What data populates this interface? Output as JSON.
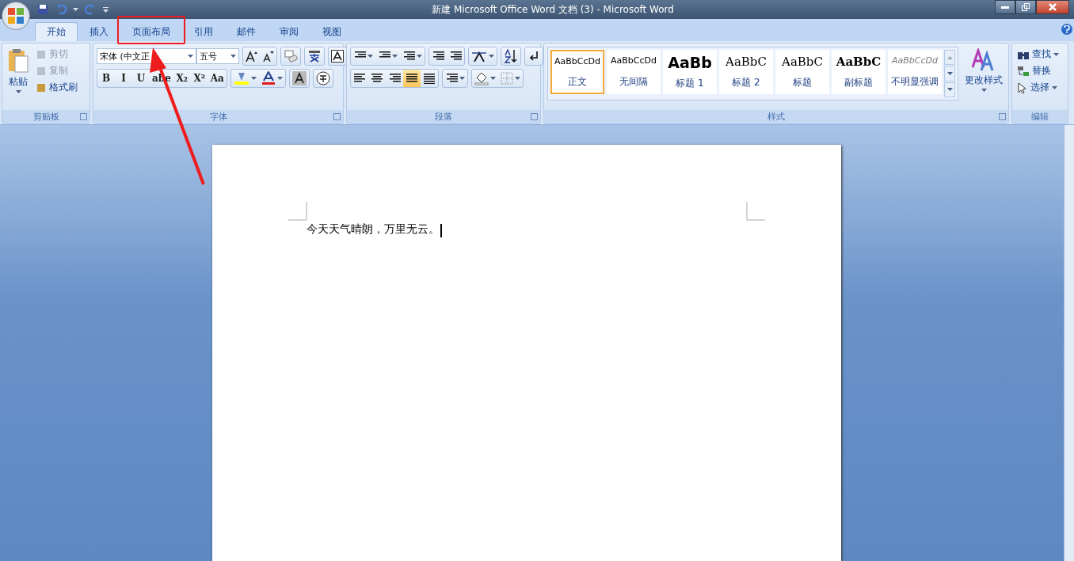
{
  "window": {
    "title": "新建 Microsoft Office Word 文档 (3) - Microsoft Word"
  },
  "tabs": [
    {
      "label": "开始",
      "selected": true,
      "highlighted": false
    },
    {
      "label": "插入",
      "selected": false,
      "highlighted": false
    },
    {
      "label": "页面布局",
      "selected": false,
      "highlighted": true
    },
    {
      "label": "引用",
      "selected": false,
      "highlighted": false
    },
    {
      "label": "邮件",
      "selected": false,
      "highlighted": false
    },
    {
      "label": "审阅",
      "selected": false,
      "highlighted": false
    },
    {
      "label": "视图",
      "selected": false,
      "highlighted": false
    }
  ],
  "clipboard": {
    "paste": "粘贴",
    "items": [
      {
        "label": "剪切",
        "disabled": true
      },
      {
        "label": "复制",
        "disabled": true
      },
      {
        "label": "格式刷",
        "disabled": false
      }
    ],
    "label": "剪贴板"
  },
  "font": {
    "font_name": "宋体 (中文正",
    "font_size": "五号",
    "format_buttons": [
      "B",
      "I",
      "U",
      "abe",
      "X₂",
      "X²",
      "Aa"
    ],
    "label": "字体"
  },
  "paragraph": {
    "label": "段落"
  },
  "styles": {
    "items": [
      {
        "kind": "normal",
        "preview": "AaBbCcDd",
        "name": "正文",
        "selected": true
      },
      {
        "kind": "no-spacing",
        "preview": "AaBbCcDd",
        "name": "无间隔",
        "selected": false
      },
      {
        "kind": "heading1",
        "preview": "AaBb",
        "name": "标题 1",
        "selected": false
      },
      {
        "kind": "heading2",
        "preview": "AaBbC",
        "name": "标题 2",
        "selected": false
      },
      {
        "kind": "title",
        "preview": "AaBbC",
        "name": "标题",
        "selected": false
      },
      {
        "kind": "subtitle",
        "preview": "AaBbC",
        "name": "副标题",
        "selected": false
      },
      {
        "kind": "subtle",
        "preview": "AaBbCcDd",
        "name": "不明显强调",
        "selected": false
      }
    ],
    "change_styles": "更改样式",
    "label": "样式"
  },
  "editing": {
    "items": [
      {
        "kind": "find",
        "label": "查找"
      },
      {
        "kind": "replace",
        "label": "替换"
      },
      {
        "kind": "select",
        "label": "选择"
      }
    ],
    "label": "编辑"
  },
  "document": {
    "text": "今天天气晴朗，万里无云。"
  }
}
